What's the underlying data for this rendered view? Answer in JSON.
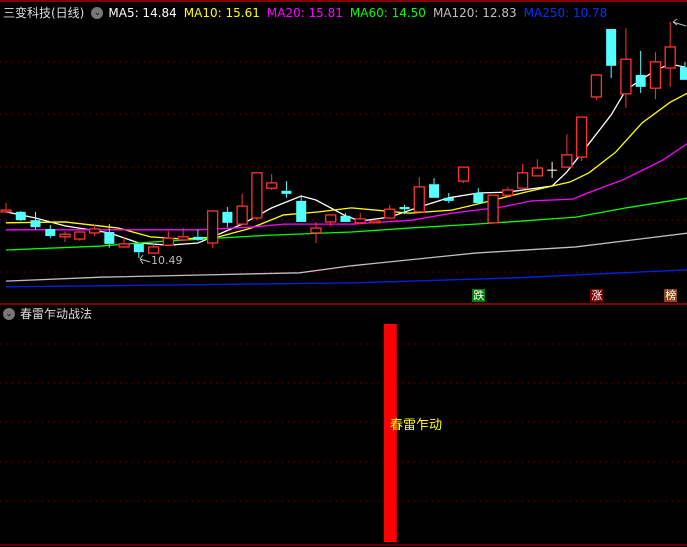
{
  "header": {
    "title": "三变科技(日线)",
    "ma": [
      {
        "label": "MA5: 14.84",
        "color": "#ffffff"
      },
      {
        "label": "MA10: 15.61",
        "color": "#ffff00"
      },
      {
        "label": "MA20: 15.81",
        "color": "#ff00ff"
      },
      {
        "label": "MA60: 14.50",
        "color": "#00ff00"
      },
      {
        "label": "MA120: 12.83",
        "color": "#c0c0c0"
      },
      {
        "label": "MA250: 10.78",
        "color": "#0033ff"
      }
    ],
    "toggle_icon": "chevron-down-icon"
  },
  "indicator": {
    "title": "春雷乍动战法",
    "signal_label": "春雷乍动",
    "signal_index": 27,
    "signal_color": "#ff0000"
  },
  "low_label": "10.49",
  "markers": [
    {
      "text": "跌",
      "index": 33,
      "bg": "#008000"
    },
    {
      "text": "涨",
      "index": 41,
      "bg": "#800000"
    },
    {
      "text": "榜",
      "index": 46,
      "bg": "#8b4513"
    }
  ],
  "chart_data": {
    "type": "candlestick",
    "ylim": [
      9.53,
      15.96
    ],
    "grid": "dotted-horizontal",
    "up_color": "#ff3333",
    "down_color": "#54ffff",
    "candles": [
      [
        11.54,
        11.74,
        11.51,
        11.58
      ],
      [
        11.54,
        11.56,
        11.33,
        11.35
      ],
      [
        11.35,
        11.54,
        11.13,
        11.19
      ],
      [
        11.15,
        11.24,
        10.94,
        10.99
      ],
      [
        10.97,
        11.1,
        10.85,
        11.03
      ],
      [
        10.92,
        11.1,
        10.88,
        11.08
      ],
      [
        11.06,
        11.24,
        10.99,
        11.15
      ],
      [
        11.08,
        11.26,
        10.72,
        10.81
      ],
      [
        10.74,
        10.97,
        10.72,
        10.81
      ],
      [
        10.81,
        10.81,
        10.49,
        10.62
      ],
      [
        10.6,
        10.81,
        10.6,
        10.74
      ],
      [
        10.78,
        11.1,
        10.78,
        10.94
      ],
      [
        10.9,
        11.17,
        10.9,
        10.97
      ],
      [
        10.97,
        11.13,
        10.88,
        10.9
      ],
      [
        10.83,
        11.56,
        10.72,
        11.56
      ],
      [
        11.54,
        11.65,
        11.19,
        11.29
      ],
      [
        11.26,
        11.95,
        11.26,
        11.67
      ],
      [
        11.4,
        12.43,
        11.35,
        12.43
      ],
      [
        12.08,
        12.4,
        12.04,
        12.2
      ],
      [
        12.02,
        12.24,
        11.86,
        11.95
      ],
      [
        11.79,
        11.92,
        11.31,
        11.31
      ],
      [
        11.06,
        11.31,
        10.83,
        11.17
      ],
      [
        11.31,
        11.47,
        11.22,
        11.47
      ],
      [
        11.45,
        11.51,
        11.31,
        11.31
      ],
      [
        11.29,
        11.51,
        11.29,
        11.38
      ],
      [
        11.29,
        11.33,
        11.29,
        11.33
      ],
      [
        11.4,
        11.7,
        11.4,
        11.6
      ],
      [
        11.65,
        11.7,
        11.49,
        11.6
      ],
      [
        11.54,
        12.33,
        11.54,
        12.11
      ],
      [
        12.17,
        12.31,
        11.86,
        11.86
      ],
      [
        11.86,
        11.97,
        11.74,
        11.79
      ],
      [
        12.24,
        12.56,
        12.2,
        12.56
      ],
      [
        11.97,
        12.08,
        11.74,
        11.74
      ],
      [
        11.29,
        11.92,
        11.29,
        11.92
      ],
      [
        11.92,
        12.11,
        11.86,
        12.04
      ],
      [
        12.08,
        12.63,
        12.08,
        12.43
      ],
      [
        12.36,
        12.74,
        12.36,
        12.54
      ],
      [
        12.49,
        12.68,
        12.31,
        12.49
      ],
      [
        12.56,
        13.31,
        12.56,
        12.84
      ],
      [
        12.79,
        13.7,
        12.7,
        13.7
      ],
      [
        14.16,
        14.66,
        14.09,
        14.66
      ],
      [
        15.71,
        15.71,
        14.59,
        14.87
      ],
      [
        14.23,
        15.73,
        13.91,
        15.02
      ],
      [
        14.66,
        15.21,
        14.25,
        14.39
      ],
      [
        14.36,
        15.18,
        14.11,
        14.96
      ],
      [
        14.82,
        15.87,
        14.39,
        15.3
      ],
      [
        14.84,
        14.96,
        14.55,
        14.55
      ]
    ],
    "series": [
      {
        "name": "MA5",
        "color": "#ffffff",
        "points": [
          [
            1,
            11.54
          ],
          [
            3,
            11.4
          ],
          [
            5,
            11.22
          ],
          [
            8,
            11.06
          ],
          [
            10,
            10.83
          ],
          [
            12,
            10.78
          ],
          [
            14,
            10.83
          ],
          [
            15,
            10.97
          ],
          [
            17,
            11.26
          ],
          [
            19,
            11.63
          ],
          [
            21,
            11.9
          ],
          [
            22,
            11.81
          ],
          [
            24,
            11.45
          ],
          [
            25,
            11.33
          ],
          [
            27,
            11.42
          ],
          [
            29,
            11.65
          ],
          [
            31,
            11.86
          ],
          [
            33,
            11.97
          ],
          [
            35,
            11.99
          ],
          [
            38,
            12.13
          ],
          [
            39,
            12.45
          ],
          [
            40,
            12.88
          ],
          [
            42,
            13.75
          ],
          [
            43,
            14.32
          ],
          [
            45,
            14.77
          ],
          [
            46,
            14.91
          ],
          [
            47,
            14.84
          ]
        ]
      },
      {
        "name": "MA10",
        "color": "#ffff00",
        "points": [
          [
            1,
            11.29
          ],
          [
            5,
            11.31
          ],
          [
            8.6,
            11.17
          ],
          [
            10.8,
            10.97
          ],
          [
            13,
            10.92
          ],
          [
            15.4,
            10.97
          ],
          [
            17.6,
            11.17
          ],
          [
            19.8,
            11.47
          ],
          [
            22.2,
            11.54
          ],
          [
            24.4,
            11.63
          ],
          [
            28.3,
            11.51
          ],
          [
            31.2,
            11.58
          ],
          [
            33.2,
            11.74
          ],
          [
            36.2,
            11.99
          ],
          [
            39.2,
            12.22
          ],
          [
            40.5,
            12.43
          ],
          [
            42.3,
            12.9
          ],
          [
            44.1,
            13.57
          ],
          [
            46,
            14.04
          ],
          [
            47.3,
            14.27
          ]
        ]
      },
      {
        "name": "MA20",
        "color": "#ff00ff",
        "points": [
          [
            1,
            11.13
          ],
          [
            14,
            11.13
          ],
          [
            17.6,
            11.19
          ],
          [
            19.8,
            11.26
          ],
          [
            24.4,
            11.26
          ],
          [
            28.5,
            11.35
          ],
          [
            31.2,
            11.51
          ],
          [
            34.6,
            11.65
          ],
          [
            36.6,
            11.79
          ],
          [
            39.4,
            11.83
          ],
          [
            40.4,
            11.97
          ],
          [
            42.8,
            12.27
          ],
          [
            45.5,
            12.72
          ],
          [
            47.3,
            13.13
          ]
        ]
      },
      {
        "name": "MA60",
        "color": "#00ff00",
        "points": [
          [
            1,
            10.67
          ],
          [
            7.4,
            10.76
          ],
          [
            10.8,
            10.85
          ],
          [
            14.2,
            10.92
          ],
          [
            19,
            11.01
          ],
          [
            24.4,
            11.08
          ],
          [
            28.3,
            11.17
          ],
          [
            32.8,
            11.26
          ],
          [
            35.1,
            11.31
          ],
          [
            39.6,
            11.42
          ],
          [
            43,
            11.63
          ],
          [
            47.3,
            11.86
          ]
        ]
      },
      {
        "name": "MA120",
        "color": "#c0c0c0",
        "points": [
          [
            1,
            9.96
          ],
          [
            7.4,
            10.05
          ],
          [
            14.2,
            10.1
          ],
          [
            20.9,
            10.15
          ],
          [
            24.4,
            10.31
          ],
          [
            32.8,
            10.6
          ],
          [
            39.6,
            10.74
          ],
          [
            47.3,
            11.06
          ]
        ]
      },
      {
        "name": "MA250",
        "color": "#0022ee",
        "points": [
          [
            1,
            9.83
          ],
          [
            11.5,
            9.87
          ],
          [
            24.4,
            9.92
          ],
          [
            35.1,
            10.03
          ],
          [
            47.3,
            10.22
          ]
        ]
      }
    ]
  }
}
